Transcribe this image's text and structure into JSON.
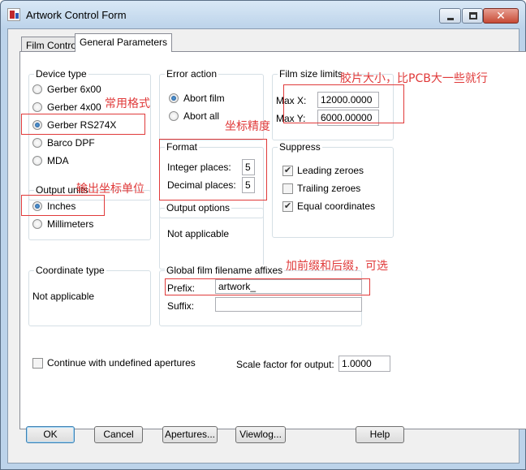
{
  "window": {
    "title": "Artwork Control Form",
    "close_glyph": "✕"
  },
  "tabs": [
    {
      "label": "Film Control"
    },
    {
      "label": "General Parameters"
    }
  ],
  "device_type": {
    "label": "Device type",
    "options": [
      "Gerber 6x00",
      "Gerber 4x00",
      "Gerber RS274X",
      "Barco DPF",
      "MDA"
    ],
    "selected": "Gerber RS274X"
  },
  "output_units": {
    "label": "Output units",
    "options": [
      "Inches",
      "Millimeters"
    ],
    "selected": "Inches"
  },
  "error_action": {
    "label": "Error action",
    "options": [
      "Abort film",
      "Abort all"
    ],
    "selected": "Abort film"
  },
  "format": {
    "label": "Format",
    "integer_label": "Integer places:",
    "integer_value": "5",
    "decimal_label": "Decimal places:",
    "decimal_value": "5"
  },
  "output_options": {
    "label": "Output options",
    "text": "Not applicable"
  },
  "film_size": {
    "label": "Film size limits",
    "max_x_label": "Max X:",
    "max_x_value": "12000.0000",
    "max_y_label": "Max Y:",
    "max_y_value": "6000.00000"
  },
  "suppress": {
    "label": "Suppress",
    "items": [
      {
        "label": "Leading zeroes",
        "checked": true
      },
      {
        "label": "Trailing zeroes",
        "checked": false
      },
      {
        "label": "Equal coordinates",
        "checked": true
      }
    ]
  },
  "coordinate_type": {
    "label": "Coordinate type",
    "text": "Not applicable"
  },
  "affixes": {
    "label": "Global film filename affixes",
    "prefix_label": "Prefix:",
    "prefix_value": "artwork_",
    "suffix_label": "Suffix:",
    "suffix_value": ""
  },
  "continue_undefined": {
    "label": "Continue with undefined apertures",
    "checked": false
  },
  "scale": {
    "label": "Scale factor for output:",
    "value": "1.0000"
  },
  "buttons": {
    "ok": "OK",
    "cancel": "Cancel",
    "apertures": "Apertures...",
    "viewlog": "Viewlog...",
    "help": "Help"
  },
  "annotations": {
    "common_format": "常用格式",
    "output_units": "输出坐标单位",
    "precision": "坐标精度",
    "film_size": "胶片大小，比PCB大一些就行",
    "affix": "加前缀和后缀，可选"
  },
  "colors": {
    "annotation": "#e03a3a",
    "title_bar": "#bcd3ea",
    "selected_radio": "#1b4f8a"
  }
}
